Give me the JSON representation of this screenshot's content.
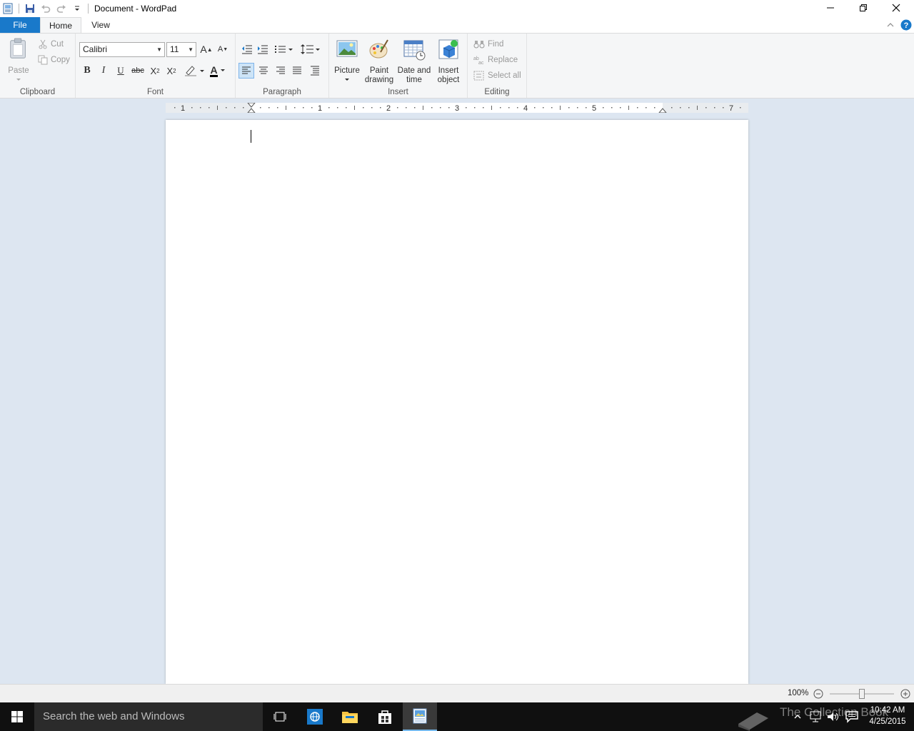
{
  "window": {
    "title": "Document - WordPad"
  },
  "tabs": {
    "file": "File",
    "home": "Home",
    "view": "View"
  },
  "clipboard": {
    "label": "Clipboard",
    "paste": "Paste",
    "cut": "Cut",
    "copy": "Copy"
  },
  "font": {
    "label": "Font",
    "family": "Calibri",
    "size": "11",
    "bold": "B",
    "italic": "I",
    "underline": "U",
    "strikethrough": "abc",
    "subscript": "X",
    "subscript_mark": "2",
    "superscript": "X",
    "superscript_mark": "2",
    "grow": "A",
    "shrink": "A",
    "text_color": "A"
  },
  "paragraph": {
    "label": "Paragraph"
  },
  "insert": {
    "label": "Insert",
    "picture": "Picture",
    "paint_line1": "Paint",
    "paint_line2": "drawing",
    "datetime_line1": "Date and",
    "datetime_line2": "time",
    "object_line1": "Insert",
    "object_line2": "object"
  },
  "editing": {
    "label": "Editing",
    "find": "Find",
    "replace": "Replace",
    "select_all": "Select all"
  },
  "ruler": {
    "numbers": [
      "1",
      "1",
      "2",
      "3",
      "4",
      "5",
      "7"
    ]
  },
  "status": {
    "zoom": "100%",
    "zoom_fraction": 0.5
  },
  "taskbar": {
    "search_placeholder": "Search the web and Windows",
    "time": "10:42 AM",
    "date": "4/25/2015",
    "watermark": "The Collection Book"
  },
  "colors": {
    "file_tab": "#1979ca",
    "ribbon_bg": "#f5f6f7",
    "workspace": "#dde6f1",
    "taskbar": "#101010",
    "help": "#1979ca"
  }
}
